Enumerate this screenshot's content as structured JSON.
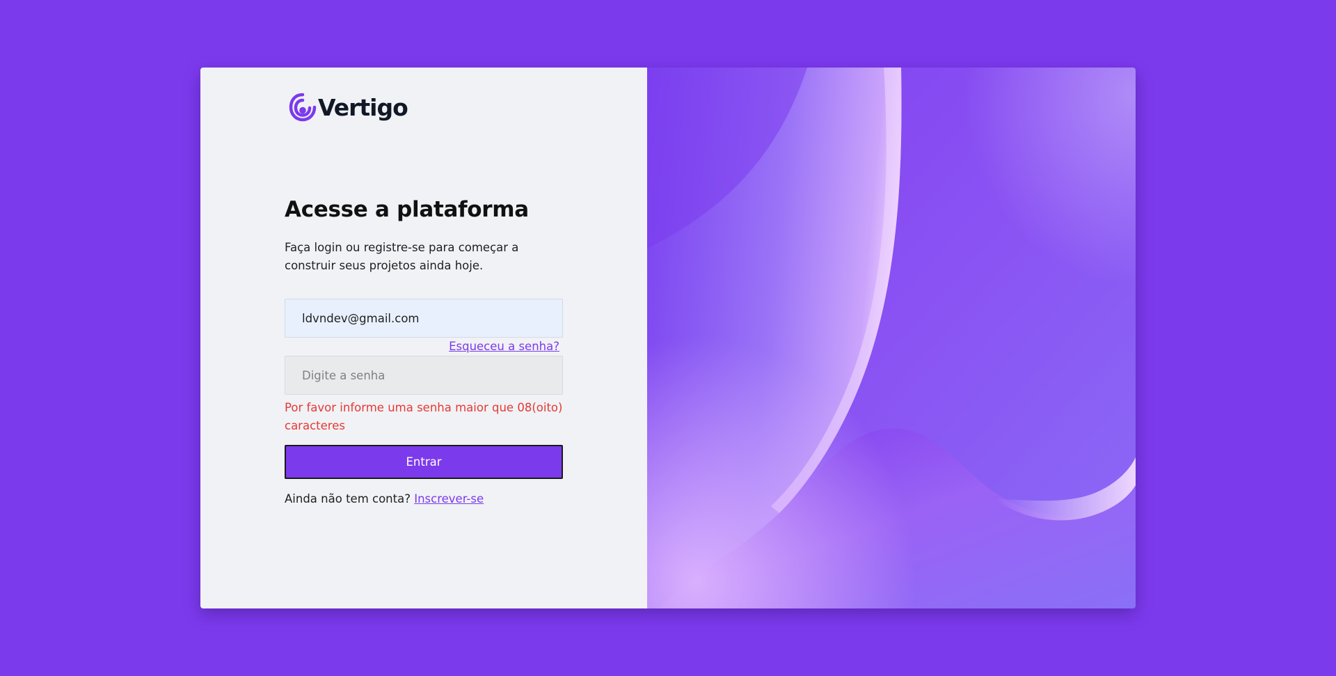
{
  "brand": {
    "name": "Vertigo",
    "logo_icon": "concentric-drop-icon",
    "accent_color": "#7c3aed"
  },
  "login": {
    "title": "Acesse a plataforma",
    "subtitle": "Faça login ou registre-se para começar a construir seus projetos ainda hoje.",
    "email_value": "ldvndev@gmail.com",
    "forgot_password_link": "Esqueceu a senha?",
    "password_placeholder": "Digite a senha",
    "password_error": "Por favor informe uma senha maior que 08(oito) caracteres",
    "submit_label": "Entrar",
    "signup_prompt": "Ainda não tem conta?",
    "signup_link": "Inscrever-se",
    "error_color": "#e53935"
  },
  "illustration": {
    "description_icon": "abstract-wave-illustration"
  }
}
